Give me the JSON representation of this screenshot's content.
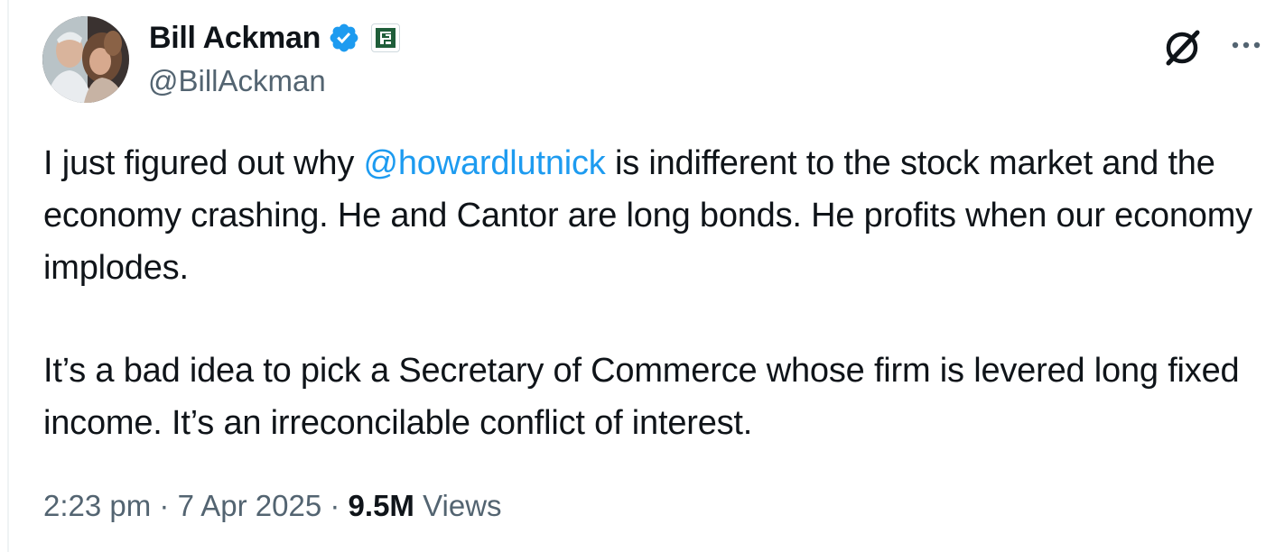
{
  "author": {
    "name": "Bill Ackman",
    "handle": "@BillAckman",
    "verified": true,
    "verified_color": "#1d9bf0",
    "affiliation_icon": "pershing-square-badge"
  },
  "actions": {
    "grok_icon": "grok-icon",
    "more_icon": "more-icon"
  },
  "tweet": {
    "paragraph1_before": "I just figured out why ",
    "mention": "@howardlutnick",
    "paragraph1_after": " is indifferent to the stock market and the economy crashing. He and Cantor are long bonds. He profits when our economy implodes.",
    "paragraph2": "It’s a bad idea to pick a Secretary of Commerce whose firm is levered long fixed income. It’s an irreconcilable conflict of interest."
  },
  "meta": {
    "time": "2:23 pm",
    "separator1": " · ",
    "date": "7 Apr 2025",
    "separator2": " · ",
    "views_count": "9.5M",
    "views_label": " Views"
  },
  "colors": {
    "link": "#1d9bf0",
    "secondary_text": "#536471",
    "primary_text": "#0f1419"
  }
}
